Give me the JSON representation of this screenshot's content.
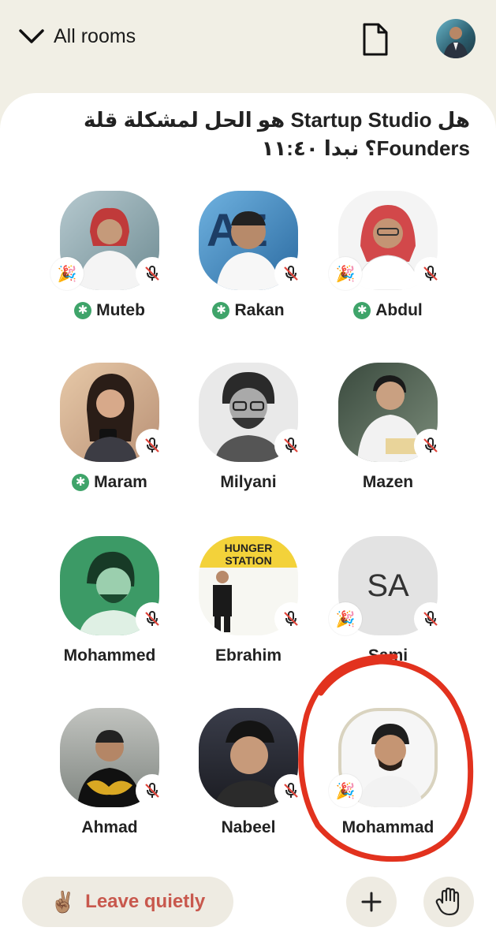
{
  "header": {
    "back_label": "All rooms"
  },
  "room": {
    "title": "هل Startup Studio هو الحل لمشكلة قلة Founders؟ نبدا ١١:٤٠"
  },
  "speakers": [
    {
      "name": "Muteb",
      "starred": true,
      "emoji": "🎉",
      "muted": true
    },
    {
      "name": "Rakan",
      "starred": true,
      "emoji": "",
      "muted": true
    },
    {
      "name": "Abdul",
      "starred": true,
      "emoji": "🎉",
      "muted": true
    },
    {
      "name": "Maram",
      "starred": true,
      "emoji": "",
      "muted": true
    },
    {
      "name": "Milyani",
      "starred": false,
      "emoji": "",
      "muted": true
    },
    {
      "name": "Mazen",
      "starred": false,
      "emoji": "",
      "muted": true
    },
    {
      "name": "Mohammed",
      "starred": false,
      "emoji": "",
      "muted": true
    },
    {
      "name": "Ebrahim",
      "starred": false,
      "emoji": "",
      "muted": true
    },
    {
      "name": "Sami",
      "starred": false,
      "emoji": "🎉",
      "muted": true,
      "initials": "SA"
    },
    {
      "name": "Ahmad",
      "starred": false,
      "emoji": "",
      "muted": true
    },
    {
      "name": "Nabeel",
      "starred": false,
      "emoji": "",
      "muted": true
    },
    {
      "name": "Mohammad",
      "starred": false,
      "emoji": "🎉",
      "muted": false
    }
  ],
  "footer": {
    "leave_emoji": "✌🏽",
    "leave_label": "Leave quietly",
    "add_icon": "plus-icon",
    "raise_hand_icon": "raise-hand-icon"
  },
  "colors": {
    "background": "#f1efe5",
    "leave_text": "#c8584d",
    "star_badge": "#3fa46a",
    "annotation_circle": "#e2321e"
  }
}
